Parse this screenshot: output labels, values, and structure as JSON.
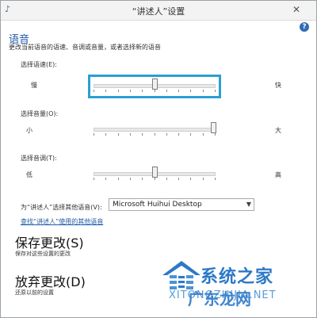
{
  "window": {
    "title": "“讲述人”设置",
    "close_glyph": "✕",
    "help_glyph": "?"
  },
  "voice_section": {
    "heading": "语音",
    "description": "更改当前语音的语速、音调或音量，或者选择新的语音"
  },
  "speed": {
    "label": "选择语速(E):",
    "min_label": "慢",
    "max_label": "快",
    "value_fraction": 0.5,
    "tick_count": 11,
    "focused": true
  },
  "volume": {
    "label": "选择音量(O):",
    "min_label": "小",
    "max_label": "大",
    "value_fraction": 0.98,
    "tick_count": 11
  },
  "pitch": {
    "label": "选择音调(T):",
    "min_label": "低",
    "max_label": "高",
    "value_fraction": 0.5,
    "tick_count": 11
  },
  "voice_select": {
    "label": "为“讲述人”选择其他语音(V):",
    "selected": "Microsoft Huihui Desktop"
  },
  "voices_link": "查找“讲述人”使用的其他语音",
  "save": {
    "title": "保存更改(S)",
    "description": "保存对这些设置的更改"
  },
  "discard": {
    "title": "放弃更改(D)",
    "description": "还原以前的设置"
  },
  "watermark": {
    "brand_cn": "系统之家",
    "brand_en": "XITONGZHIJIA.NET",
    "overlay_cn": "广东龙网"
  },
  "colors": {
    "accent": "#1e5aa8",
    "focus": "#2a9fd4",
    "watermark": "#2c79c7"
  }
}
